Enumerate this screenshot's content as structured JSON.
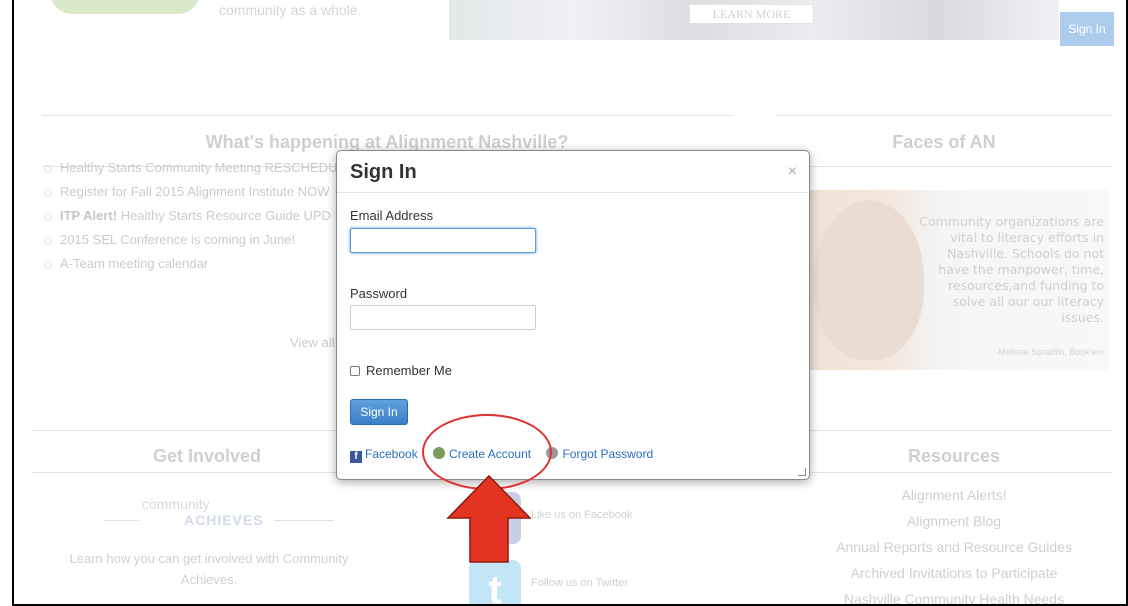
{
  "hero": {
    "text": "community as a whole.",
    "learn_more": "LEARN MORE",
    "signin": "Sign In"
  },
  "news": {
    "title": "What's happening at Alignment Nashville?",
    "items": [
      {
        "bold": "",
        "text": "Healthy Starts Community Meeting RESCHEDU"
      },
      {
        "bold": "",
        "text": "Register for Fall 2015 Alignment Institute NOW"
      },
      {
        "bold": "ITP Alert!",
        "text": " Healthy Starts Resource Guide UPD"
      },
      {
        "bold": "",
        "text": "2015 SEL Conference is coming in June!"
      },
      {
        "bold": "",
        "text": "A-Team meeting calendar"
      }
    ],
    "view_all": "View all"
  },
  "faces": {
    "title": "Faces of AN",
    "quote": "Community organizations are vital to literacy efforts in Nashville. Schools do not have the manpower, time, resources,and funding to solve all our our literacy issues.",
    "attribution": "-Melissa Spradlin, Book'em"
  },
  "get_involved": {
    "title": "Get Involved",
    "logo_word1": "community",
    "logo_word2": "ACHIEVES",
    "text": "Learn how you can get involved with Community Achieves."
  },
  "social": {
    "facebook": "Like us on Facebook",
    "twitter": "Follow us on Twitter"
  },
  "resources": {
    "title": "Resources",
    "items": [
      "Alignment Alerts!",
      "Alignment Blog",
      "Annual Reports and Resource Guides",
      "Archived Invitations to Participate",
      "Nashville Community Health Needs"
    ]
  },
  "modal": {
    "title": "Sign In",
    "close": "×",
    "email_label": "Email Address",
    "email_value": "",
    "password_label": "Password",
    "password_value": "",
    "remember_label": "Remember Me",
    "signin_button": "Sign In",
    "links": {
      "facebook": "Facebook",
      "create_account": "Create Account",
      "forgot_password": "Forgot Password"
    }
  },
  "colors": {
    "accent_blue": "#3a7fc5",
    "annotation_red": "#e53322"
  }
}
